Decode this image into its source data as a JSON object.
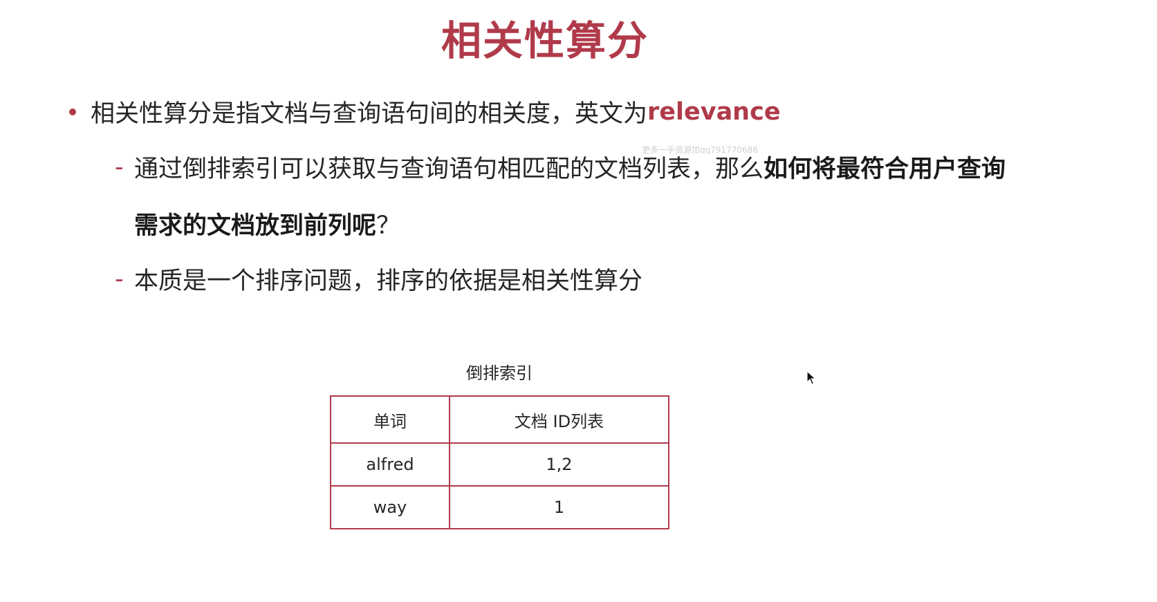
{
  "slide": {
    "title": "相关性算分",
    "bullet": {
      "text": "相关性算分是指文档与查询语句间的相关度，英文为 ",
      "highlight": "relevance"
    },
    "sub1": {
      "plain": "通过倒排索引可以获取与查询语句相匹配的文档列表，那么",
      "bold_line1": "如何将最符合用户查询",
      "bold_line2": "需求的文档放到前列呢",
      "tail": "？"
    },
    "sub2": {
      "text": "本质是一个排序问题，排序的依据是相关性算分"
    },
    "watermark": "更多一手资源加qq791770686"
  },
  "table": {
    "caption": "倒排索引",
    "headers": [
      "单词",
      "文档 ID列表"
    ],
    "rows": [
      [
        "alfred",
        "1,2"
      ],
      [
        "way",
        "1"
      ]
    ]
  },
  "colors": {
    "accent": "#b03a4a",
    "text": "#262626"
  },
  "icons": {
    "bullet": "bullet-dot-icon",
    "cursor": "mouse-pointer-icon"
  }
}
